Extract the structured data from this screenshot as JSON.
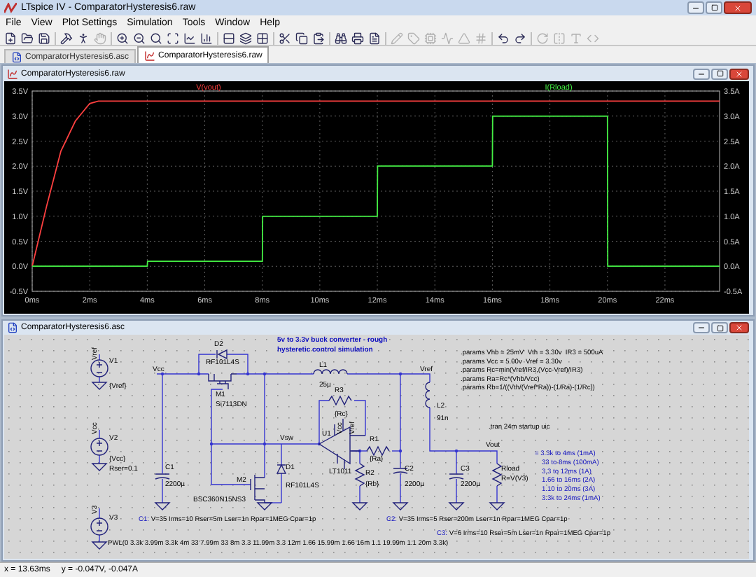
{
  "window": {
    "title": "LTspice IV - ComparatorHysteresis6.raw"
  },
  "menu": [
    "File",
    "View",
    "Plot Settings",
    "Simulation",
    "Tools",
    "Window",
    "Help"
  ],
  "toolbar": [
    {
      "disabled": false
    },
    {
      "disabled": false
    },
    {
      "disabled": false
    },
    {
      "disabled": false
    },
    {
      "disabled": false
    },
    {
      "disabled": true
    },
    {
      "disabled": false
    },
    {
      "disabled": false
    },
    {
      "disabled": false
    },
    {
      "disabled": false
    },
    {
      "disabled": false
    },
    {
      "disabled": false
    },
    {
      "disabled": false
    },
    {
      "disabled": false
    },
    {
      "disabled": false
    },
    {
      "disabled": false
    },
    {
      "disabled": false
    },
    {
      "disabled": false
    },
    {
      "disabled": false
    },
    {
      "disabled": false
    },
    {
      "disabled": false
    },
    {
      "disabled": true
    },
    {
      "disabled": true
    },
    {
      "disabled": true
    },
    {
      "disabled": true
    },
    {
      "disabled": true
    },
    {
      "disabled": true
    },
    {
      "disabled": false
    },
    {
      "disabled": false
    },
    {
      "disabled": true
    },
    {
      "disabled": true
    },
    {
      "disabled": true
    },
    {
      "disabled": true
    }
  ],
  "tabs": [
    {
      "label": "ComparatorHysteresis6.asc",
      "kind": "schematic",
      "selected": false
    },
    {
      "label": "ComparatorHysteresis6.raw",
      "kind": "waveform",
      "selected": true
    }
  ],
  "plot_window": {
    "title": "ComparatorHysteresis6.raw",
    "right_axis_ticks": [
      "3.5A",
      "3.0A",
      "2.5A",
      "2.0A",
      "1.5A",
      "1.0A",
      "0.5A",
      "0.0A",
      "-0.5A"
    ],
    "chart_data": {
      "type": "line",
      "x": [
        0,
        0.5,
        1,
        1.5,
        2,
        2.3,
        4,
        4.01,
        8,
        8.01,
        12,
        12.01,
        16,
        16.01,
        20,
        20.01,
        23.9
      ],
      "series": [
        {
          "name": "V(vout)",
          "color": "#ff4040",
          "values": [
            0,
            1.2,
            2.3,
            2.9,
            3.25,
            3.3,
            3.3,
            3.3,
            3.3,
            3.3,
            3.3,
            3.3,
            3.3,
            3.3,
            3.3,
            3.3,
            3.3
          ]
        },
        {
          "name": "I(Rload)",
          "color": "#44ee44",
          "values": [
            0,
            0,
            0,
            0,
            0,
            0,
            0,
            0.1,
            0.1,
            1,
            1,
            2,
            2,
            3,
            3,
            0,
            0
          ]
        }
      ],
      "xlim": [
        0,
        23.9
      ],
      "ylim": [
        -0.5,
        3.5
      ],
      "grid": true,
      "xticks": [
        {
          "value": 0,
          "label": "0ms"
        },
        {
          "value": 2,
          "label": "2ms"
        },
        {
          "value": 4,
          "label": "4ms"
        },
        {
          "value": 6,
          "label": "6ms"
        },
        {
          "value": 8,
          "label": "8ms"
        },
        {
          "value": 10,
          "label": "10ms"
        },
        {
          "value": 12,
          "label": "12ms"
        },
        {
          "value": 14,
          "label": "14ms"
        },
        {
          "value": 16,
          "label": "16ms"
        },
        {
          "value": 18,
          "label": "18ms"
        },
        {
          "value": 20,
          "label": "20ms"
        },
        {
          "value": 22,
          "label": "22ms"
        }
      ],
      "yticks": [
        {
          "value": -0.5,
          "label": "-0.5V"
        },
        {
          "value": 0,
          "label": "0.0V"
        },
        {
          "value": 0.5,
          "label": "0.5V"
        },
        {
          "value": 1,
          "label": "1.0V"
        },
        {
          "value": 1.5,
          "label": "1.5V"
        },
        {
          "value": 2,
          "label": "2.0V"
        },
        {
          "value": 2.5,
          "label": "2.5V"
        },
        {
          "value": 3,
          "label": "3.0V"
        },
        {
          "value": 3.5,
          "label": "3.5V"
        }
      ]
    }
  },
  "schematic_window": {
    "title": "ComparatorHysteresis6.asc",
    "note": [
      "5v to 3.3v buck converter - rough",
      "hysteretic control simulation"
    ],
    "labels": [
      "Vref",
      "V1",
      "{Vref}",
      "Vcc",
      "V2",
      "{Vcc}",
      "Rser=0.1",
      "V3",
      "V3",
      "Vcc",
      "D2",
      "RF101L4S",
      "M1",
      "Si7113DN",
      "L1",
      "25µ",
      "R3",
      "{Rc}",
      "Vsw",
      "U1",
      "Vcc",
      "Vref",
      "LT1011",
      "C1",
      "2200µ",
      "M2",
      "BSC360N15NS3",
      "D1",
      "RF101L4S",
      "R1",
      "{Ra}",
      "R2",
      "{Rb}",
      "Vref",
      "L2",
      "91n",
      "Vout",
      "C2",
      "2200µ",
      "C3",
      "2200µ",
      "Rload",
      "R=V(V3)"
    ],
    "directives": [
      ".params Vhb = 25mV  Vth = 3.30v  IR3 = 500uA",
      ".params Vcc = 5.00v  Vref = 3.30v",
      ".params Rc=min(Vref/IR3,(Vcc-Vref)/IR3)",
      ".params Ra=Rc*(Vhb/Vcc)",
      ".params Rb=1/((Vth/(Vref*Ra))-(1/Ra)-(1/Rc))"
    ],
    "analysis": ".tran 24m startup uic",
    "load_steps": [
      "= 3.3k to 4ms (1mA)",
      "33 to 8ms (100mA)",
      "3.3 to 12ms (1A)",
      "1.66 to 16ms (2A)",
      "1.10 to 20ms (3A)",
      "3.3k to 24ms (1mA)"
    ],
    "part_specs": [
      {
        "ref": "C1:",
        "spec": "V=35 Irms=10 Rser=5m Lser=1n Rpar=1MEG Cpar=1p"
      },
      {
        "ref": "C2:",
        "spec": "V=35 Irms=5 Rser=200m Lser=1n Rpar=1MEG Cpar=1p"
      },
      {
        "ref": "C3:",
        "spec": "V=6 Irms=10 Rser=5m Lser=1n Rpar=1MEG Cpar=1p"
      }
    ],
    "pwl": "PWL(0 3.3k 3.99m 3.3k 4m 33 7.99m 33 8m 3.3 11.99m 3.3 12m 1.66 15.99m 1.66 16m 1.1 19.99m 1.1 20m 3.3k)"
  },
  "status_bar": {
    "x": "x = 13.63ms",
    "y": "y = -0.047V, -0.047A"
  }
}
